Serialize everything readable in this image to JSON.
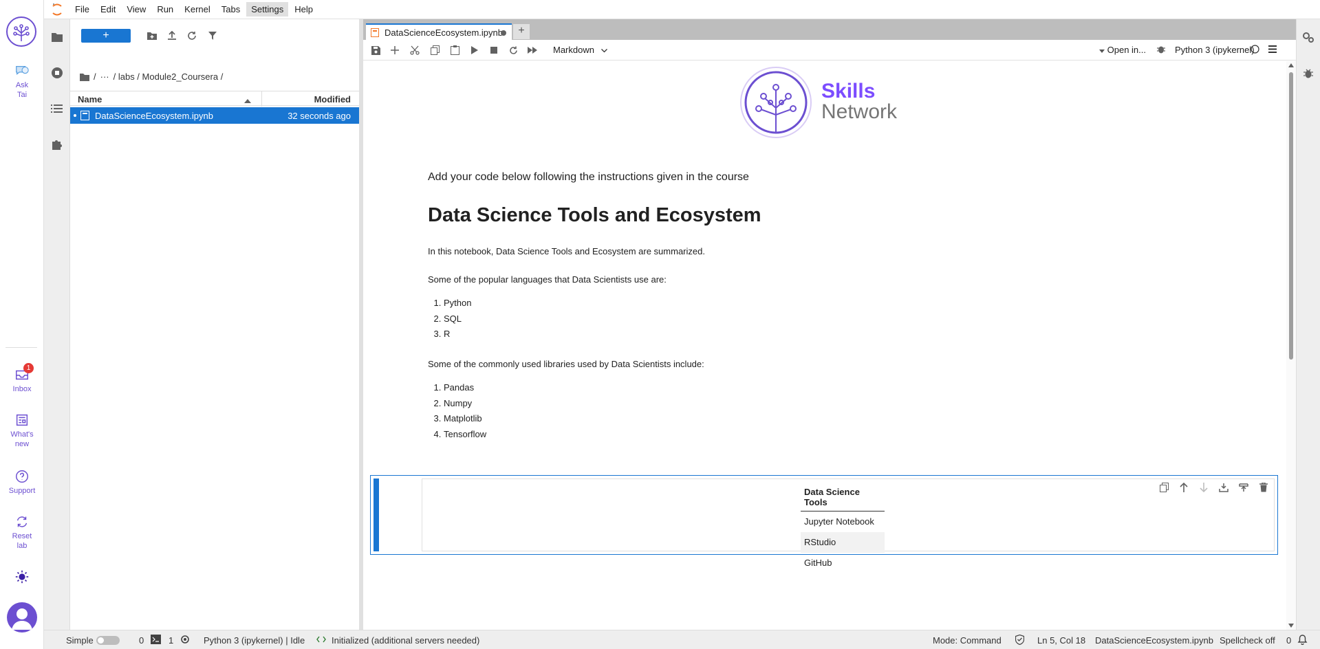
{
  "rail": {
    "ask_tai": "Ask\nTai",
    "ask_line1": "Ask",
    "ask_line2": "Tai",
    "inbox": "Inbox",
    "inbox_badge": "1",
    "whats_new_line1": "What's",
    "whats_new_line2": "new",
    "support": "Support",
    "reset_line1": "Reset",
    "reset_line2": "lab"
  },
  "menubar": {
    "items": [
      "File",
      "Edit",
      "View",
      "Run",
      "Kernel",
      "Tabs",
      "Settings",
      "Help"
    ],
    "active": "Settings"
  },
  "filebrowser": {
    "new_label": "+",
    "breadcrumb": [
      "/",
      "···",
      "/ labs / Module2_Coursera /"
    ],
    "col_name": "Name",
    "col_modified": "Modified",
    "files": [
      {
        "name": "DataScienceEcosystem.ipynb",
        "modified": "32 seconds ago"
      }
    ]
  },
  "tab": {
    "title": "DataScienceEcosystem.ipynb",
    "add": "+"
  },
  "toolbar": {
    "cell_type": "Markdown",
    "open_in": "Open in...",
    "kernel": "Python 3 (ipykernel)"
  },
  "notebook": {
    "logo_line1": "Skills",
    "logo_line2": "Network",
    "instruction": "Add your code below following the instructions given in the course",
    "title": "Data Science Tools and Ecosystem",
    "intro": "In this notebook, Data Science Tools and Ecosystem are summarized.",
    "languages_intro": "Some of the popular languages that Data Scientists use are:",
    "languages": [
      "Python",
      "SQL",
      "R"
    ],
    "libraries_intro": "Some of the commonly used libraries used by Data Scientists include:",
    "libraries": [
      "Pandas",
      "Numpy",
      "Matplotlib",
      "Tensorflow"
    ],
    "table_header": "Data Science Tools",
    "table_rows": [
      "Jupyter Notebook",
      "RStudio",
      "GitHub"
    ]
  },
  "statusbar": {
    "simple": "Simple",
    "count_a": "0",
    "count_b": "1",
    "kernel_status": "Python 3 (ipykernel) | Idle",
    "init_status": "Initialized (additional servers needed)",
    "mode": "Mode: Command",
    "position": "Ln 5, Col 18",
    "file": "DataScienceEcosystem.ipynb",
    "spellcheck": "Spellcheck off",
    "notifications": "0"
  },
  "colors": {
    "accent": "#1976d2",
    "brand": "#6c4fd1"
  }
}
